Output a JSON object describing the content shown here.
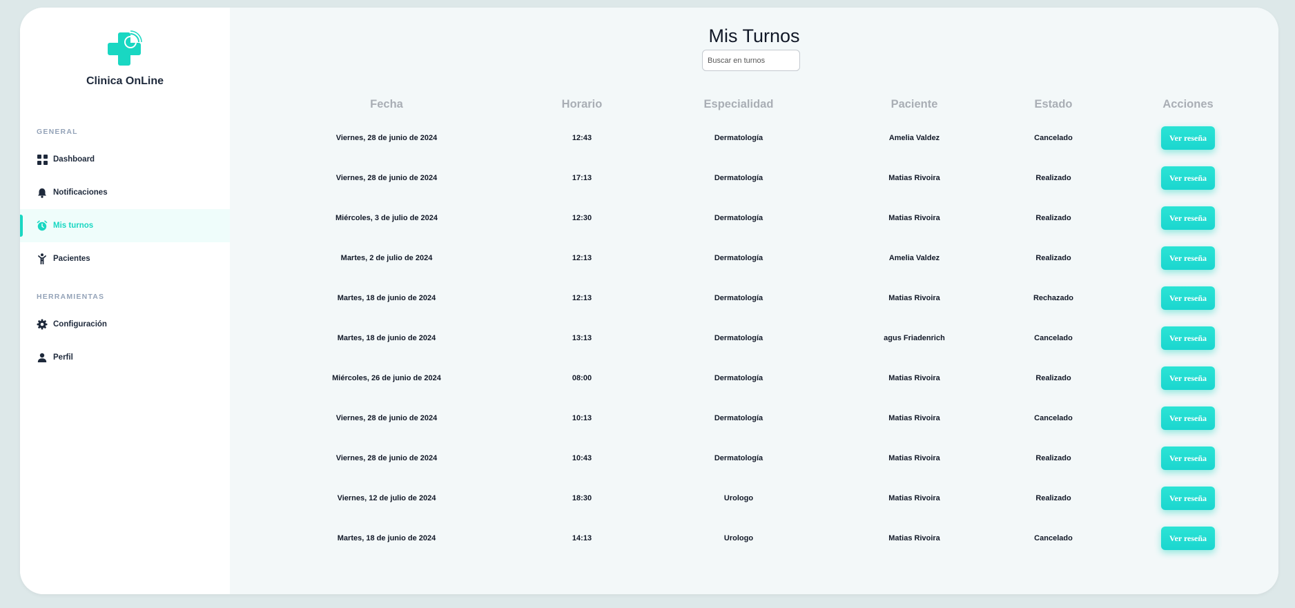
{
  "brand": {
    "name": "Clinica OnLine"
  },
  "sidebar": {
    "sections": [
      {
        "label": "GENERAL"
      },
      {
        "label": "HERRAMIENTAS"
      }
    ],
    "items": [
      {
        "label": "Dashboard",
        "icon": "grid-icon"
      },
      {
        "label": "Notificaciones",
        "icon": "bell-icon"
      },
      {
        "label": "Mis turnos",
        "icon": "alarm-clock-icon",
        "active": true
      },
      {
        "label": "Pacientes",
        "icon": "person-icon"
      },
      {
        "label": "Configuración",
        "icon": "gear-icon"
      },
      {
        "label": "Perfil",
        "icon": "user-icon"
      }
    ]
  },
  "main": {
    "title": "Mis Turnos",
    "search_placeholder": "Buscar en turnos",
    "columns": [
      "Fecha",
      "Horario",
      "Especialidad",
      "Paciente",
      "Estado",
      "Acciones"
    ],
    "rows": [
      {
        "fecha": "Viernes, 28 de junio de 2024",
        "horario": "12:43",
        "especialidad": "Dermatología",
        "paciente": "Amelia Valdez",
        "estado": "Cancelado",
        "accion": "Ver reseña"
      },
      {
        "fecha": "Viernes, 28 de junio de 2024",
        "horario": "17:13",
        "especialidad": "Dermatología",
        "paciente": "Matias Rivoira",
        "estado": "Realizado",
        "accion": "Ver reseña"
      },
      {
        "fecha": "Miércoles, 3 de julio de 2024",
        "horario": "12:30",
        "especialidad": "Dermatología",
        "paciente": "Matias Rivoira",
        "estado": "Realizado",
        "accion": "Ver reseña"
      },
      {
        "fecha": "Martes, 2 de julio de 2024",
        "horario": "12:13",
        "especialidad": "Dermatología",
        "paciente": "Amelia Valdez",
        "estado": "Realizado",
        "accion": "Ver reseña"
      },
      {
        "fecha": "Martes, 18 de junio de 2024",
        "horario": "12:13",
        "especialidad": "Dermatología",
        "paciente": "Matias Rivoira",
        "estado": "Rechazado",
        "accion": "Ver reseña"
      },
      {
        "fecha": "Martes, 18 de junio de 2024",
        "horario": "13:13",
        "especialidad": "Dermatología",
        "paciente": "agus Friadenrich",
        "estado": "Cancelado",
        "accion": "Ver reseña"
      },
      {
        "fecha": "Miércoles, 26 de junio de 2024",
        "horario": "08:00",
        "especialidad": "Dermatología",
        "paciente": "Matias Rivoira",
        "estado": "Realizado",
        "accion": "Ver reseña"
      },
      {
        "fecha": "Viernes, 28 de junio de 2024",
        "horario": "10:13",
        "especialidad": "Dermatología",
        "paciente": "Matias Rivoira",
        "estado": "Cancelado",
        "accion": "Ver reseña"
      },
      {
        "fecha": "Viernes, 28 de junio de 2024",
        "horario": "10:43",
        "especialidad": "Dermatología",
        "paciente": "Matias Rivoira",
        "estado": "Realizado",
        "accion": "Ver reseña"
      },
      {
        "fecha": "Viernes, 12 de julio de 2024",
        "horario": "18:30",
        "especialidad": "Urologo",
        "paciente": "Matias Rivoira",
        "estado": "Realizado",
        "accion": "Ver reseña"
      },
      {
        "fecha": "Martes, 18 de junio de 2024",
        "horario": "14:13",
        "especialidad": "Urologo",
        "paciente": "Matias Rivoira",
        "estado": "Cancelado",
        "accion": "Ver reseña"
      }
    ]
  },
  "colors": {
    "accent": "#19d7c2",
    "background": "#dde8e9",
    "text": "#111827",
    "header_muted": "#a9aeb5"
  }
}
